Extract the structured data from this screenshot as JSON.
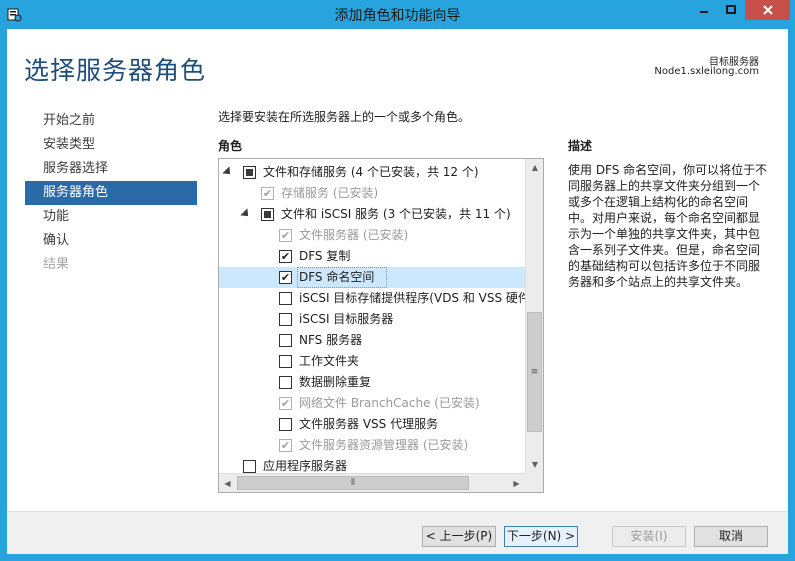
{
  "window": {
    "title": "添加角色和功能向导"
  },
  "header": {
    "page_title": "选择服务器角色",
    "destination_label": "目标服务器",
    "destination_value": "Node1.sxleilong.com"
  },
  "nav": {
    "items": [
      {
        "label": "开始之前",
        "state": "normal"
      },
      {
        "label": "安装类型",
        "state": "normal"
      },
      {
        "label": "服务器选择",
        "state": "normal"
      },
      {
        "label": "服务器角色",
        "state": "active"
      },
      {
        "label": "功能",
        "state": "normal"
      },
      {
        "label": "确认",
        "state": "normal"
      },
      {
        "label": "结果",
        "state": "disabled"
      }
    ]
  },
  "main": {
    "instruction": "选择要安装在所选服务器上的一个或多个角色。",
    "roles_header": "角色",
    "description_header": "描述",
    "description_text": "使用 DFS 命名空间，你可以将位于不同服务器上的共享文件夹分组到一个或多个在逻辑上结构化的命名空间中。对用户来说，每个命名空间都显示为一个单独的共享文件夹，其中包含一系列子文件夹。但是，命名空间的基础结构可以包括许多位于不同服务器和多个站点上的共享文件夹。"
  },
  "roles": [
    {
      "label": "文件和存储服务 (4 个已安装，共 12 个)",
      "level": 0,
      "expander": true,
      "check": "partial",
      "dim": false,
      "selected": false
    },
    {
      "label": "存储服务 (已安装)",
      "level": 1,
      "expander": false,
      "check": "checked",
      "dim": true,
      "selected": false
    },
    {
      "label": "文件和 iSCSI 服务 (3 个已安装，共 11 个)",
      "level": 1,
      "expander": true,
      "check": "partial",
      "dim": false,
      "selected": false
    },
    {
      "label": "文件服务器 (已安装)",
      "level": 2,
      "expander": false,
      "check": "checked",
      "dim": true,
      "selected": false
    },
    {
      "label": "DFS 复制",
      "level": 2,
      "expander": false,
      "check": "checked",
      "dim": false,
      "selected": false
    },
    {
      "label": "DFS 命名空间",
      "level": 2,
      "expander": false,
      "check": "checked",
      "dim": false,
      "selected": true
    },
    {
      "label": "iSCSI 目标存储提供程序(VDS 和 VSS 硬件提",
      "level": 2,
      "expander": false,
      "check": "unchecked",
      "dim": false,
      "selected": false
    },
    {
      "label": "iSCSI 目标服务器",
      "level": 2,
      "expander": false,
      "check": "unchecked",
      "dim": false,
      "selected": false
    },
    {
      "label": "NFS 服务器",
      "level": 2,
      "expander": false,
      "check": "unchecked",
      "dim": false,
      "selected": false
    },
    {
      "label": "工作文件夹",
      "level": 2,
      "expander": false,
      "check": "unchecked",
      "dim": false,
      "selected": false
    },
    {
      "label": "数据删除重复",
      "level": 2,
      "expander": false,
      "check": "unchecked",
      "dim": false,
      "selected": false
    },
    {
      "label": "网络文件 BranchCache (已安装)",
      "level": 2,
      "expander": false,
      "check": "checked",
      "dim": true,
      "selected": false
    },
    {
      "label": "文件服务器 VSS 代理服务",
      "level": 2,
      "expander": false,
      "check": "unchecked",
      "dim": false,
      "selected": false
    },
    {
      "label": "文件服务器资源管理器 (已安装)",
      "level": 2,
      "expander": false,
      "check": "checked",
      "dim": true,
      "selected": false
    },
    {
      "label": "应用程序服务器",
      "level": 0,
      "expander": false,
      "check": "unchecked",
      "dim": false,
      "selected": false
    }
  ],
  "footer": {
    "prev_label": "< 上一步(P)",
    "next_label": "下一步(N) >",
    "install_label": "安装(I)",
    "cancel_label": "取消"
  }
}
